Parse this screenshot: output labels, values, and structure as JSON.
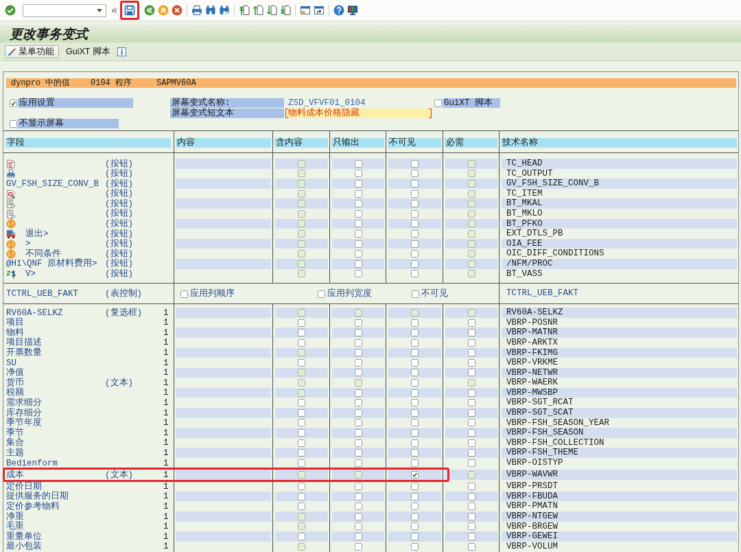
{
  "toolbar": {
    "groups": [
      {
        "items": [
          {
            "kind": "enter",
            "highlighted": false
          },
          {
            "kind": "command_field",
            "highlighted": false
          },
          {
            "kind": "expand",
            "highlighted": false
          },
          {
            "kind": "save",
            "highlighted": true
          },
          {
            "kind": "back",
            "highlighted": false
          },
          {
            "kind": "exit",
            "highlighted": false
          },
          {
            "kind": "cancel",
            "highlighted": false
          }
        ]
      },
      {
        "items": [
          {
            "kind": "print",
            "highlighted": false
          },
          {
            "kind": "find",
            "highlighted": false
          },
          {
            "kind": "find_next",
            "highlighted": false
          }
        ]
      },
      {
        "items": [
          {
            "kind": "first_page",
            "highlighted": false
          },
          {
            "kind": "prev_page",
            "highlighted": false
          },
          {
            "kind": "next_page",
            "highlighted": false
          },
          {
            "kind": "last_page",
            "highlighted": false
          }
        ]
      },
      {
        "items": [
          {
            "kind": "new_session",
            "highlighted": false
          },
          {
            "kind": "shortcut",
            "highlighted": false
          }
        ]
      },
      {
        "items": [
          {
            "kind": "help",
            "highlighted": false
          },
          {
            "kind": "layout",
            "highlighted": false
          }
        ]
      }
    ]
  },
  "title": "更改事务变式",
  "app_toolbar": {
    "menu_button": "菜单功能",
    "guixt_button": "GuiXT 脚本"
  },
  "dynpro_bar": {
    "label": "dynpro 中的值",
    "dynpro": "0104",
    "program_label": "程序",
    "program": "SAPMV60A"
  },
  "settings": {
    "apply_settings": {
      "label": "应用设置",
      "checked": true
    },
    "screen_variant_name": {
      "label": "屏幕变式名称:",
      "value": "ZSD_VFVF01_0104"
    },
    "guixt_script": {
      "label": "GuiXT 脚本",
      "checked": false
    },
    "screen_variant_text": {
      "label": "屏幕变式短文本",
      "value": "物料成本价格隐藏"
    },
    "hide_screen": {
      "label": "不显示屏幕",
      "checked": false
    }
  },
  "columns": [
    "字段",
    "内容",
    "含内容",
    "只输出",
    "不可见",
    "必需",
    "技术名称"
  ],
  "button_rows": [
    {
      "kind": "chart",
      "type": "(按钮)",
      "tech_name": "TC_HEAD",
      "checks": [
        {
          "checked": false,
          "disabled": true
        },
        {
          "checked": false,
          "disabled": false
        },
        {
          "checked": false,
          "disabled": false
        },
        {
          "checked": false,
          "disabled": true
        }
      ]
    },
    {
      "kind": "printer",
      "type": "(按钮)",
      "tech_name": "TC_OUTPUT",
      "checks": [
        {
          "checked": false,
          "disabled": true
        },
        {
          "checked": false,
          "disabled": false
        },
        {
          "checked": false,
          "disabled": false
        },
        {
          "checked": false,
          "disabled": true
        }
      ]
    },
    {
      "kind": "text",
      "field": "GV_FSH_SIZE_CONV_B",
      "type": "(按钮)",
      "tech_name": "GV_FSH_SIZE_CONV_B",
      "checks": [
        {
          "checked": false,
          "disabled": true
        },
        {
          "checked": false,
          "disabled": false
        },
        {
          "checked": false,
          "disabled": false
        },
        {
          "checked": false,
          "disabled": true
        }
      ]
    },
    {
      "kind": "magnifier",
      "type": "(按钮)",
      "tech_name": "TC_ITEM",
      "checks": [
        {
          "checked": false,
          "disabled": true
        },
        {
          "checked": false,
          "disabled": false
        },
        {
          "checked": false,
          "disabled": false
        },
        {
          "checked": false,
          "disabled": true
        }
      ]
    },
    {
      "kind": "list",
      "type": "(按钮)",
      "tech_name": "BT_MKAL",
      "checks": [
        {
          "checked": false,
          "disabled": true
        },
        {
          "checked": false,
          "disabled": false
        },
        {
          "checked": false,
          "disabled": false
        },
        {
          "checked": false,
          "disabled": true
        }
      ]
    },
    {
      "kind": "document",
      "type": "(按钮)",
      "tech_name": "BT_MKLO",
      "checks": [
        {
          "checked": false,
          "disabled": true
        },
        {
          "checked": false,
          "disabled": false
        },
        {
          "checked": false,
          "disabled": false
        },
        {
          "checked": false,
          "disabled": true
        }
      ]
    },
    {
      "kind": "coin",
      "type": "(按钮)",
      "tech_name": "BT_PFKO",
      "checks": [
        {
          "checked": false,
          "disabled": true
        },
        {
          "checked": false,
          "disabled": false
        },
        {
          "checked": false,
          "disabled": false
        },
        {
          "checked": false,
          "disabled": true
        }
      ]
    },
    {
      "kind": "truck",
      "field": "退出>",
      "type": "(按钮)",
      "tech_name": "EXT_DTLS_PB",
      "checks": [
        {
          "checked": false,
          "disabled": true
        },
        {
          "checked": false,
          "disabled": false
        },
        {
          "checked": false,
          "disabled": false
        },
        {
          "checked": false,
          "disabled": true
        }
      ]
    },
    {
      "kind": "coin",
      "field": ">",
      "type": "(按钮)",
      "tech_name": "OIA_FEE",
      "checks": [
        {
          "checked": false,
          "disabled": true
        },
        {
          "checked": false,
          "disabled": false
        },
        {
          "checked": false,
          "disabled": false
        },
        {
          "checked": false,
          "disabled": true
        }
      ]
    },
    {
      "kind": "coin",
      "field": "不同条件",
      "type": "(按钮)",
      "tech_name": "OIC_DIFF_CONDITIONS",
      "checks": [
        {
          "checked": false,
          "disabled": true
        },
        {
          "checked": false,
          "disabled": false
        },
        {
          "checked": false,
          "disabled": false
        },
        {
          "checked": false,
          "disabled": true
        }
      ]
    },
    {
      "kind": "text",
      "field": "@H1\\QNF 原材料费用>",
      "type": "(按钮)",
      "tech_name": "/NFM/PROC",
      "checks": [
        {
          "checked": false,
          "disabled": true
        },
        {
          "checked": false,
          "disabled": false
        },
        {
          "checked": false,
          "disabled": false
        },
        {
          "checked": false,
          "disabled": true
        }
      ]
    },
    {
      "kind": "money",
      "field": "V>",
      "type": "(按钮)",
      "tech_name": "BT_VASS",
      "checks": [
        {
          "checked": false,
          "disabled": true
        },
        {
          "checked": false,
          "disabled": false
        },
        {
          "checked": false,
          "disabled": false
        },
        {
          "checked": false,
          "disabled": true
        }
      ]
    }
  ],
  "table_control": {
    "name": "TCTRL_UEB_FAKT",
    "type": "(表控制)",
    "options": [
      {
        "label": "应用列顺序",
        "checked": false
      },
      {
        "label": "应用列宽度",
        "checked": false
      },
      {
        "label": "不可见",
        "checked": false
      }
    ],
    "tech_name": "TCTRL_UEB_FAKT"
  },
  "table_rows": [
    {
      "field": "RV60A-SELKZ",
      "type": "(复选框)",
      "count": "1",
      "tech_name": "RV60A-SELKZ",
      "highlighted": false,
      "checks": [
        {
          "checked": false,
          "disabled": true
        },
        {
          "checked": false,
          "disabled": true
        },
        {
          "checked": false,
          "disabled": true
        },
        {
          "checked": false,
          "disabled": true
        }
      ]
    },
    {
      "field": "项目",
      "count": "1",
      "tech_name": "VBRP-POSNR",
      "highlighted": false,
      "checks": [
        {
          "checked": false,
          "disabled": false
        },
        {
          "checked": false,
          "disabled": false
        },
        {
          "checked": false,
          "disabled": false
        },
        {
          "checked": false,
          "disabled": false
        }
      ]
    },
    {
      "field": "物料",
      "count": "1",
      "tech_name": "VBRP-MATNR",
      "highlighted": false,
      "checks": [
        {
          "checked": false,
          "disabled": false
        },
        {
          "checked": false,
          "disabled": false
        },
        {
          "checked": false,
          "disabled": false
        },
        {
          "checked": false,
          "disabled": false
        }
      ]
    },
    {
      "field": "项目描述",
      "count": "1",
      "tech_name": "VBRP-ARKTX",
      "highlighted": false,
      "checks": [
        {
          "checked": false,
          "disabled": false
        },
        {
          "checked": false,
          "disabled": false
        },
        {
          "checked": false,
          "disabled": false
        },
        {
          "checked": false,
          "disabled": false
        }
      ]
    },
    {
      "field": "开票数量",
      "count": "1",
      "tech_name": "VBRP-FKIMG",
      "highlighted": false,
      "checks": [
        {
          "checked": false,
          "disabled": true
        },
        {
          "checked": false,
          "disabled": false
        },
        {
          "checked": false,
          "disabled": false
        },
        {
          "checked": false,
          "disabled": false
        }
      ]
    },
    {
      "field": "SU",
      "count": "1",
      "tech_name": "VBRP-VRKME",
      "highlighted": false,
      "checks": [
        {
          "checked": false,
          "disabled": false
        },
        {
          "checked": false,
          "disabled": false
        },
        {
          "checked": false,
          "disabled": false
        },
        {
          "checked": false,
          "disabled": false
        }
      ]
    },
    {
      "field": "净值",
      "count": "1",
      "tech_name": "VBRP-NETWR",
      "highlighted": false,
      "checks": [
        {
          "checked": false,
          "disabled": true
        },
        {
          "checked": false,
          "disabled": false
        },
        {
          "checked": false,
          "disabled": false
        },
        {
          "checked": false,
          "disabled": false
        }
      ]
    },
    {
      "field": "货币",
      "type": "(文本)",
      "count": "1",
      "tech_name": "VBRP-WAERK",
      "highlighted": false,
      "checks": [
        {
          "checked": false,
          "disabled": true
        },
        {
          "checked": false,
          "disabled": true
        },
        {
          "checked": false,
          "disabled": false
        },
        {
          "checked": false,
          "disabled": true
        }
      ]
    },
    {
      "field": "税额",
      "count": "1",
      "tech_name": "VBRP-MWSBP",
      "highlighted": false,
      "checks": [
        {
          "checked": false,
          "disabled": true
        },
        {
          "checked": false,
          "disabled": false
        },
        {
          "checked": false,
          "disabled": false
        },
        {
          "checked": false,
          "disabled": false
        }
      ]
    },
    {
      "field": "需求细分",
      "count": "1",
      "tech_name": "VBRP-SGT_RCAT",
      "highlighted": false,
      "checks": [
        {
          "checked": false,
          "disabled": false
        },
        {
          "checked": false,
          "disabled": false
        },
        {
          "checked": false,
          "disabled": false
        },
        {
          "checked": false,
          "disabled": false
        }
      ]
    },
    {
      "field": "库存细分",
      "count": "1",
      "tech_name": "VBRP-SGT_SCAT",
      "highlighted": false,
      "checks": [
        {
          "checked": false,
          "disabled": false
        },
        {
          "checked": false,
          "disabled": false
        },
        {
          "checked": false,
          "disabled": false
        },
        {
          "checked": false,
          "disabled": false
        }
      ]
    },
    {
      "field": "季节年度",
      "count": "1",
      "tech_name": "VBRP-FSH_SEASON_YEAR",
      "highlighted": false,
      "checks": [
        {
          "checked": false,
          "disabled": false
        },
        {
          "checked": false,
          "disabled": false
        },
        {
          "checked": false,
          "disabled": false
        },
        {
          "checked": false,
          "disabled": false
        }
      ]
    },
    {
      "field": "季节",
      "count": "1",
      "tech_name": "VBRP-FSH_SEASON",
      "highlighted": false,
      "checks": [
        {
          "checked": false,
          "disabled": false
        },
        {
          "checked": false,
          "disabled": false
        },
        {
          "checked": false,
          "disabled": false
        },
        {
          "checked": false,
          "disabled": false
        }
      ]
    },
    {
      "field": "集合",
      "count": "1",
      "tech_name": "VBRP-FSH_COLLECTION",
      "highlighted": false,
      "checks": [
        {
          "checked": false,
          "disabled": false
        },
        {
          "checked": false,
          "disabled": false
        },
        {
          "checked": false,
          "disabled": false
        },
        {
          "checked": false,
          "disabled": false
        }
      ]
    },
    {
      "field": "主题",
      "count": "1",
      "tech_name": "VBRP-FSH_THEME",
      "highlighted": false,
      "checks": [
        {
          "checked": false,
          "disabled": false
        },
        {
          "checked": false,
          "disabled": false
        },
        {
          "checked": false,
          "disabled": false
        },
        {
          "checked": false,
          "disabled": false
        }
      ]
    },
    {
      "field": "Bedienform",
      "count": "1",
      "tech_name": "VBRP-OISTYP",
      "highlighted": false,
      "checks": [
        {
          "checked": false,
          "disabled": false
        },
        {
          "checked": false,
          "disabled": false
        },
        {
          "checked": false,
          "disabled": false
        },
        {
          "checked": false,
          "disabled": false
        }
      ]
    },
    {
      "field": "成本",
      "type": "(文本)",
      "count": "1",
      "tech_name": "VBRP-WAVWR",
      "highlighted": true,
      "checks": [
        {
          "checked": false,
          "disabled": true
        },
        {
          "checked": false,
          "disabled": true
        },
        {
          "checked": true,
          "disabled": false
        },
        {
          "checked": false,
          "disabled": true
        }
      ]
    },
    {
      "field": "定价日期",
      "count": "1",
      "tech_name": "VBRP-PRSDT",
      "highlighted": false,
      "checks": [
        {
          "checked": false,
          "disabled": false
        },
        {
          "checked": false,
          "disabled": false
        },
        {
          "checked": false,
          "disabled": false
        },
        {
          "checked": false,
          "disabled": false
        }
      ]
    },
    {
      "field": "提供服务的日期",
      "count": "1",
      "tech_name": "VBRP-FBUDA",
      "highlighted": false,
      "checks": [
        {
          "checked": false,
          "disabled": false
        },
        {
          "checked": false,
          "disabled": false
        },
        {
          "checked": false,
          "disabled": false
        },
        {
          "checked": false,
          "disabled": false
        }
      ]
    },
    {
      "field": "定价参考物料",
      "count": "1",
      "tech_name": "VBRP-PMATN",
      "highlighted": false,
      "checks": [
        {
          "checked": false,
          "disabled": false
        },
        {
          "checked": false,
          "disabled": false
        },
        {
          "checked": false,
          "disabled": false
        },
        {
          "checked": false,
          "disabled": false
        }
      ]
    },
    {
      "field": "净重",
      "count": "1",
      "tech_name": "VBRP-NTGEW",
      "highlighted": false,
      "checks": [
        {
          "checked": false,
          "disabled": true
        },
        {
          "checked": false,
          "disabled": false
        },
        {
          "checked": false,
          "disabled": false
        },
        {
          "checked": false,
          "disabled": false
        }
      ]
    },
    {
      "field": "毛重",
      "count": "1",
      "tech_name": "VBRP-BRGEW",
      "highlighted": false,
      "checks": [
        {
          "checked": false,
          "disabled": true
        },
        {
          "checked": false,
          "disabled": false
        },
        {
          "checked": false,
          "disabled": false
        },
        {
          "checked": false,
          "disabled": false
        }
      ]
    },
    {
      "field": "重量单位",
      "count": "1",
      "tech_name": "VBRP-GEWEI",
      "highlighted": false,
      "checks": [
        {
          "checked": false,
          "disabled": false
        },
        {
          "checked": false,
          "disabled": false
        },
        {
          "checked": false,
          "disabled": false
        },
        {
          "checked": false,
          "disabled": false
        }
      ]
    },
    {
      "field": "最小包装",
      "count": "1",
      "tech_name": "VBRP-VOLUM",
      "highlighted": false,
      "checks": [
        {
          "checked": false,
          "disabled": true
        },
        {
          "checked": false,
          "disabled": false
        },
        {
          "checked": false,
          "disabled": false
        },
        {
          "checked": false,
          "disabled": false
        }
      ]
    }
  ]
}
